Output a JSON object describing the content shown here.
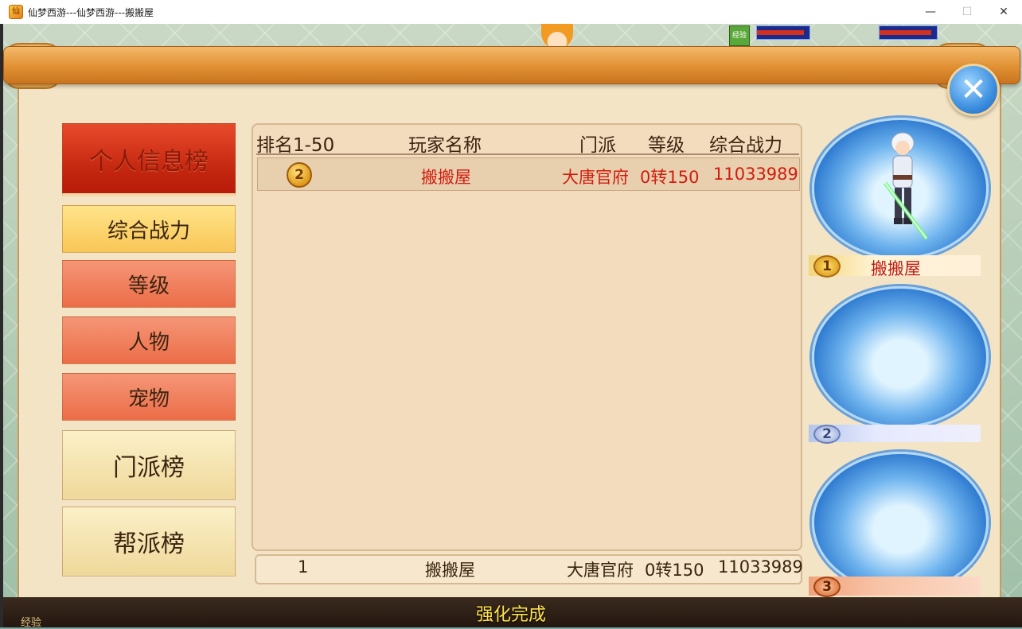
{
  "window": {
    "title": "仙梦西游---仙梦西游---搬搬屋",
    "controls": [
      "—",
      "☐",
      "✕"
    ]
  },
  "sidebar": {
    "main_tab": "个人信息榜",
    "sub_tabs": [
      "综合战力",
      "等级",
      "人物",
      "宠物"
    ],
    "selected_sub_tab": "综合战力",
    "other_tabs": [
      "门派榜",
      "帮派榜"
    ]
  },
  "table": {
    "headers": {
      "rank": "排名1-50",
      "player_name": "玩家名称",
      "sect": "门派",
      "level": "等级",
      "power": "综合战力"
    },
    "rows": [
      {
        "rank_icon": "2",
        "player_name": "搬搬屋",
        "sect": "大唐官府",
        "level": "0转150",
        "power": "11033989"
      }
    ],
    "my_row": {
      "rank": "1",
      "player_name": "搬搬屋",
      "sect": "大唐官府",
      "level": "0转150",
      "power": "11033989"
    }
  },
  "podium": {
    "first": {
      "badge": "1",
      "name": "搬搬屋"
    },
    "second": {
      "badge": "2",
      "name": ""
    },
    "third": {
      "badge": "3",
      "name": ""
    }
  },
  "status_text": "强化完成",
  "bottom_left_label": "经验",
  "hud_icon_text": "经验"
}
